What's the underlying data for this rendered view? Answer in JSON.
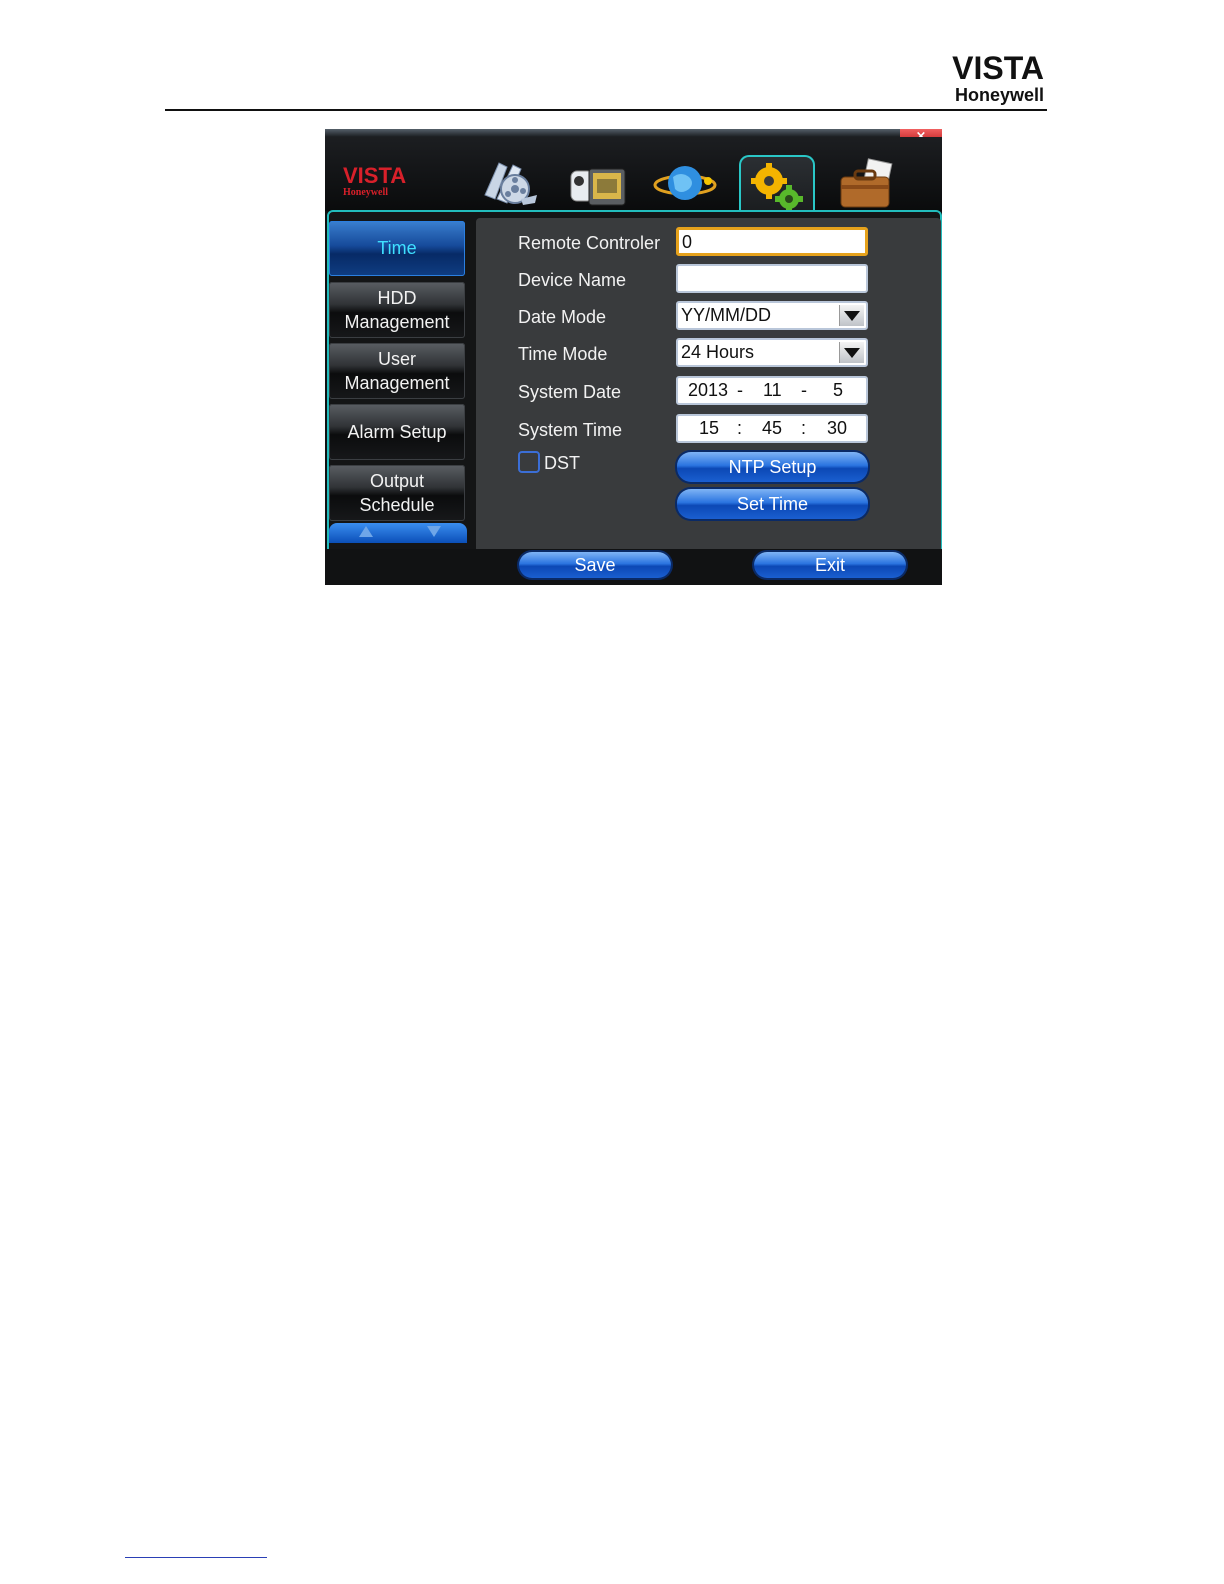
{
  "page_header": {
    "brand_title": "VISTA",
    "brand_subtitle": "Honeywell"
  },
  "window": {
    "close_glyph": "×",
    "logo_title": "VISTA",
    "logo_subtitle": "Honeywell",
    "tabs": [
      {
        "name": "playback-film-icon"
      },
      {
        "name": "camcorder-icon"
      },
      {
        "name": "network-globe-icon"
      },
      {
        "name": "settings-gears-icon",
        "active": true
      },
      {
        "name": "toolbox-briefcase-icon"
      }
    ],
    "accent_color": "#22bcbc"
  },
  "menu": {
    "items": [
      {
        "label_line1": "Time",
        "label_line2": ""
      },
      {
        "label_line1": "HDD",
        "label_line2": "Management"
      },
      {
        "label_line1": "User",
        "label_line2": "Management"
      },
      {
        "label_line1": "Alarm Setup",
        "label_line2": ""
      },
      {
        "label_line1": "Output",
        "label_line2": "Schedule"
      }
    ]
  },
  "form": {
    "remote_controller": {
      "label": "Remote Controler",
      "value": "0"
    },
    "device_name": {
      "label": "Device Name",
      "value": ""
    },
    "date_mode": {
      "label": "Date Mode",
      "value": "YY/MM/DD"
    },
    "time_mode": {
      "label": "Time Mode",
      "value": "24 Hours"
    },
    "system_date": {
      "label": "System Date",
      "year": "2013",
      "sep1": "-",
      "month": "11",
      "sep2": "-",
      "day": "5"
    },
    "system_time": {
      "label": "System Time",
      "hour": "15",
      "sep1": ":",
      "minute": "45",
      "sep2": ":",
      "second": "30"
    },
    "dst": {
      "label": "DST",
      "checked": false
    },
    "ntp_button": "NTP Setup",
    "set_time_button": "Set Time"
  },
  "footer_buttons": {
    "save": "Save",
    "exit": "Exit"
  }
}
